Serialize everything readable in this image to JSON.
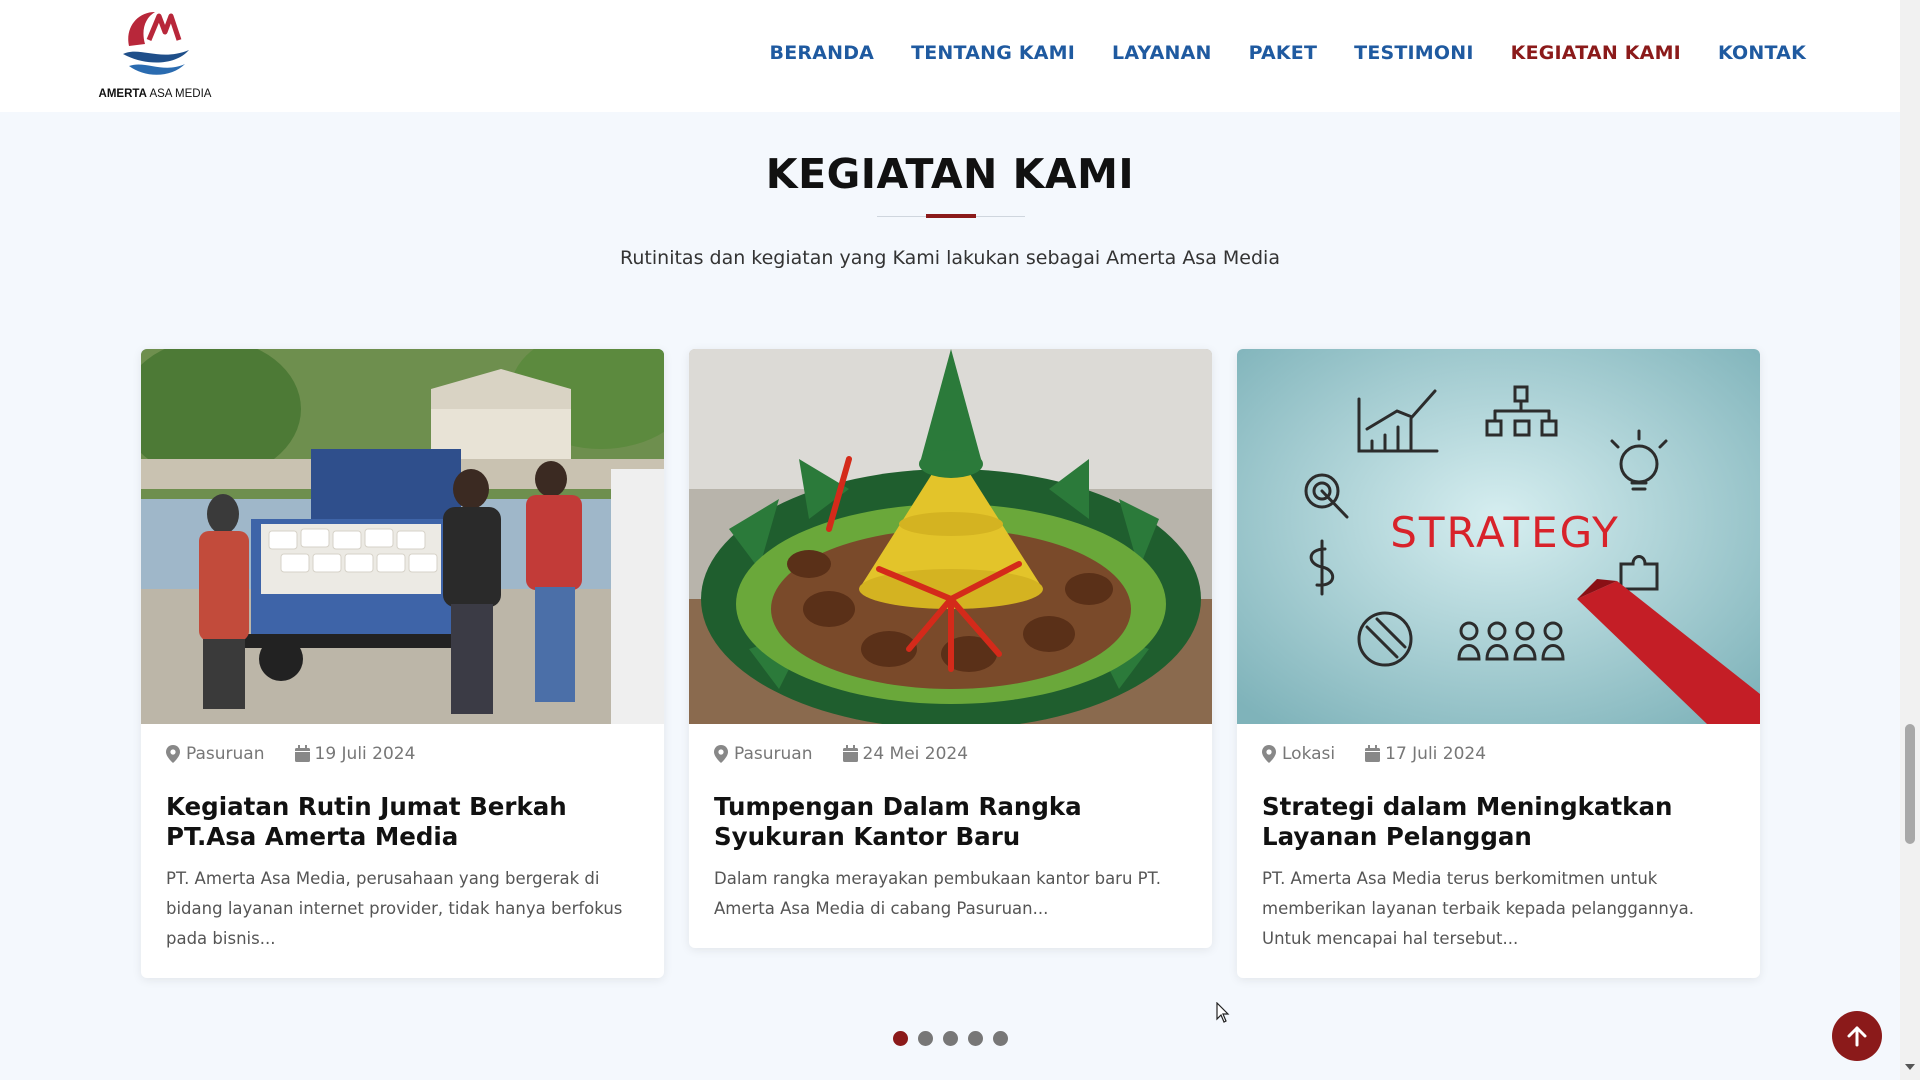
{
  "brand": {
    "name_bold": "AMERTA",
    "name_rest": " ASA MEDIA",
    "accent": "#8b1a1a",
    "primary": "#1f5aa0"
  },
  "nav": [
    {
      "label": "BERANDA",
      "active": false
    },
    {
      "label": "TENTANG KAMI",
      "active": false
    },
    {
      "label": "LAYANAN",
      "active": false
    },
    {
      "label": "PAKET",
      "active": false
    },
    {
      "label": "TESTIMONI",
      "active": false
    },
    {
      "label": "KEGIATAN KAMI",
      "active": true
    },
    {
      "label": "KONTAK",
      "active": false
    }
  ],
  "section": {
    "title": "KEGIATAN KAMI",
    "subtitle": "Rutinitas dan kegiatan yang Kami lakukan sebagai Amerta Asa Media"
  },
  "cards": [
    {
      "location": "Pasuruan",
      "date": "19 Juli 2024",
      "title_line1": "Kegiatan Rutin Jumat Berkah",
      "title_line2": "PT.Asa Amerta Media",
      "text_line1": "PT. Amerta Asa Media, perusahaan yang bergerak di",
      "text_line2": "bidang layanan internet provider, tidak hanya berfokus",
      "text_line3": "pada bisnis...",
      "image_icon": "charity-photo-icon"
    },
    {
      "location": "Pasuruan",
      "date": "24 Mei 2024",
      "title_line1": "Tumpengan Dalam Rangka",
      "title_line2": "Syukuran Kantor Baru",
      "text_line1": "Dalam rangka merayakan pembukaan kantor baru PT.",
      "text_line2": "Amerta Asa Media di cabang Pasuruan...",
      "text_line3": "",
      "image_icon": "tumpeng-photo-icon"
    },
    {
      "location": "Lokasi",
      "date": "17 Juli 2024",
      "title_line1": "Strategi dalam Meningkatkan",
      "title_line2": "Layanan Pelanggan",
      "text_line1": "PT. Amerta Asa Media terus berkomitmen untuk",
      "text_line2": "memberikan layanan terbaik kepada pelanggannya.",
      "text_line3": "Untuk mencapai hal tersebut...",
      "image_icon": "strategy-photo-icon",
      "image_word": "STRATEGY"
    }
  ],
  "carousel": {
    "pages": 5,
    "current": 1
  },
  "icons": {
    "location": "map-pin-icon",
    "date": "calendar-icon",
    "back_to_top": "arrow-up-icon"
  }
}
